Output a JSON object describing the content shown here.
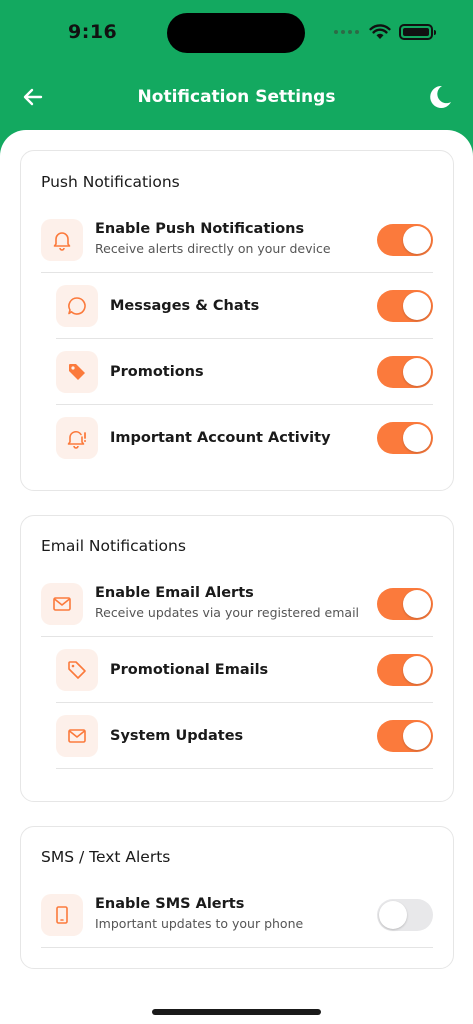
{
  "status_bar": {
    "time": "9:16"
  },
  "header": {
    "title": "Notification Settings"
  },
  "colors": {
    "primary": "#13a960",
    "accent": "#fb7a3c",
    "icon_bg": "#fdf0ea",
    "toggle_off": "#e8e8ea"
  },
  "sections": [
    {
      "title": "Push Notifications",
      "items": [
        {
          "icon": "bell-icon",
          "label": "Enable Push Notifications",
          "description": "Receive alerts directly on your device",
          "enabled": true
        },
        {
          "icon": "chat-bubble-icon",
          "label": "Messages & Chats",
          "enabled": true
        },
        {
          "icon": "tag-icon",
          "label": "Promotions",
          "enabled": true
        },
        {
          "icon": "alert-bell-icon",
          "label": "Important Account Activity",
          "enabled": true
        }
      ]
    },
    {
      "title": "Email Notifications",
      "items": [
        {
          "icon": "mail-icon",
          "label": "Enable Email Alerts",
          "description": "Receive updates via your registered email",
          "enabled": true
        },
        {
          "icon": "tag-outline-icon",
          "label": "Promotional Emails",
          "enabled": true
        },
        {
          "icon": "mail-icon",
          "label": "System Updates",
          "enabled": true
        }
      ]
    },
    {
      "title": "SMS / Text Alerts",
      "items": [
        {
          "icon": "phone-icon",
          "label": "Enable SMS Alerts",
          "description": "Important updates to your phone",
          "enabled": false
        }
      ]
    }
  ]
}
